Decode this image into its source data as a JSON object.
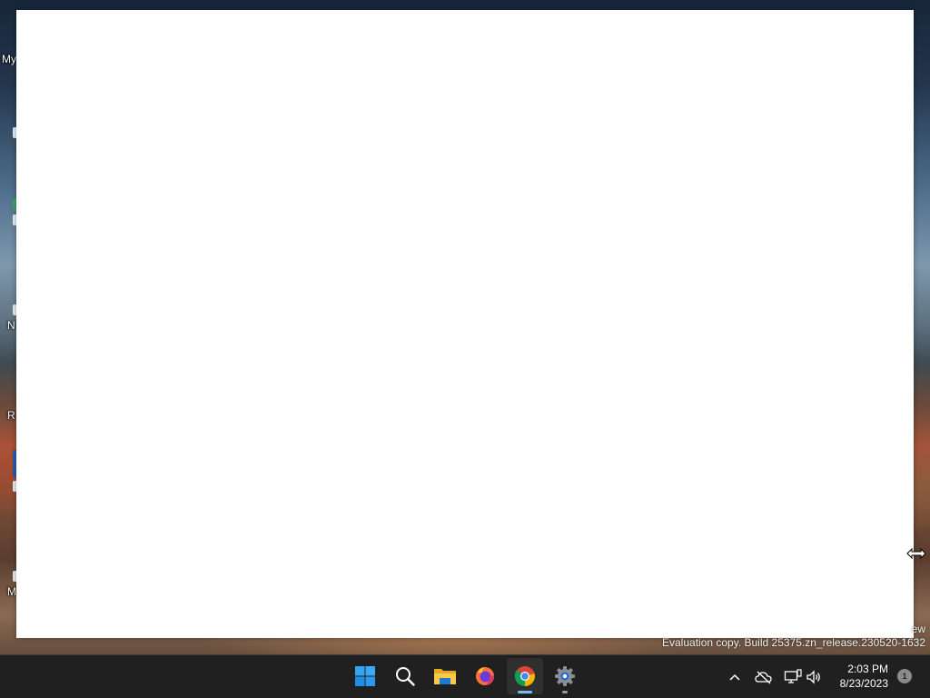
{
  "desktop": {
    "icons": [
      {
        "label": "My",
        "icon": "folder-icon"
      },
      {
        "label": "",
        "icon": "file-icon"
      },
      {
        "label": "",
        "icon": "app-icon"
      },
      {
        "label": "N",
        "icon": "file-icon"
      },
      {
        "label": "R",
        "icon": "recycle-bin-icon"
      },
      {
        "label": "",
        "icon": "app-icon"
      },
      {
        "label": "M",
        "icon": "file-icon"
      }
    ],
    "watermark": {
      "line1": "ew",
      "line2": "Evaluation copy. Build 25375.zn_release.230520-1632"
    }
  },
  "taskbar": {
    "apps": [
      {
        "name": "Start",
        "icon": "windows-logo-icon"
      },
      {
        "name": "Search",
        "icon": "search-icon"
      },
      {
        "name": "File Explorer",
        "icon": "folder-icon"
      },
      {
        "name": "Firefox",
        "icon": "firefox-icon"
      },
      {
        "name": "Google Chrome",
        "icon": "chrome-icon",
        "active": true
      },
      {
        "name": "Settings",
        "icon": "gear-icon",
        "running": true
      }
    ],
    "tray": {
      "overflow_icon": "chevron-up-icon",
      "onedrive_icon": "cloud-off-icon",
      "network_icon": "network-icon",
      "volume_icon": "volume-icon"
    },
    "clock": {
      "time": "2:03 PM",
      "date": "8/23/2023"
    },
    "notifications": {
      "count": "1"
    }
  }
}
